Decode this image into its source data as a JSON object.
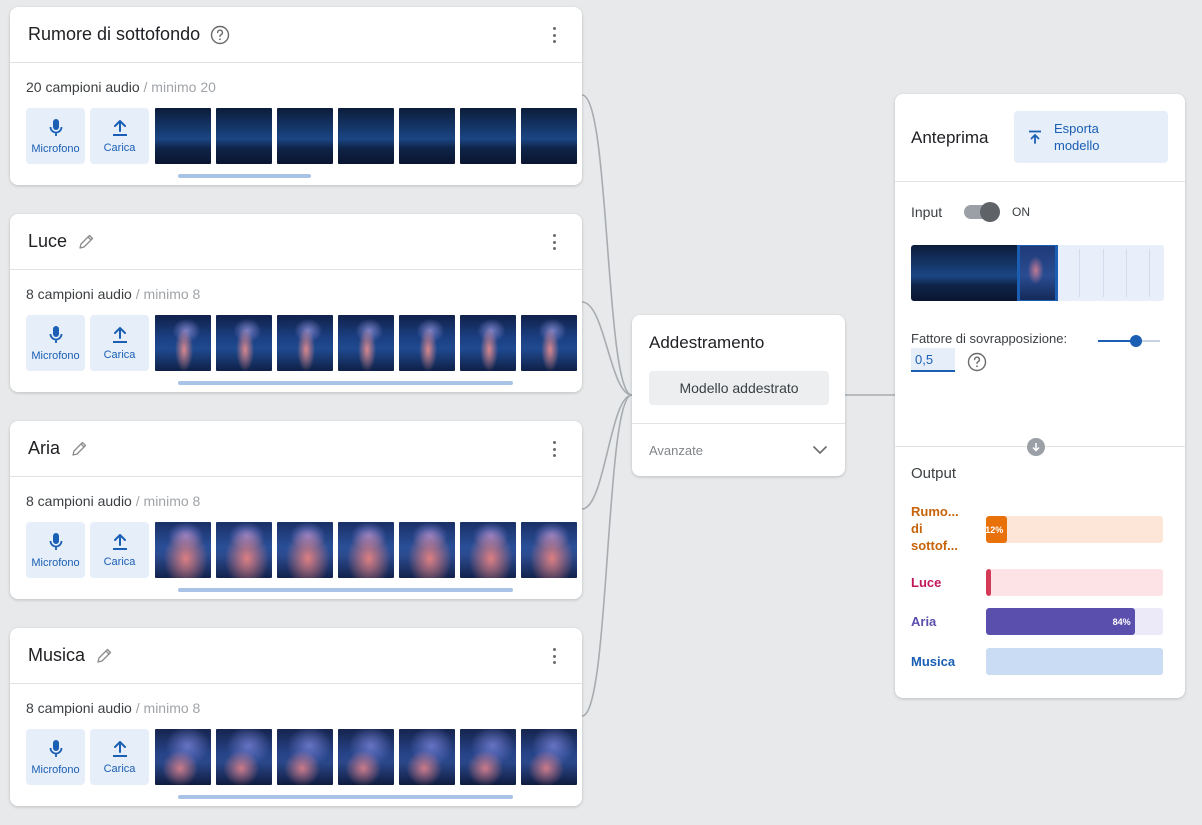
{
  "classes": [
    {
      "title": "Rumore di sottofondo",
      "count": "20 campioni audio",
      "minimum": "/ minimo 20",
      "microphone_label": "Microfono",
      "upload_label": "Carica",
      "head_icon": "help-circle-icon",
      "spectrogram_style": "background-noise"
    },
    {
      "title": "Luce",
      "count": "8 campioni audio",
      "minimum": "/ minimo 8",
      "microphone_label": "Microfono",
      "upload_label": "Carica",
      "head_icon": "pencil-icon",
      "spectrogram_style": "voice"
    },
    {
      "title": "Aria",
      "count": "8 campioni audio",
      "minimum": "/ minimo 8",
      "microphone_label": "Microfono",
      "upload_label": "Carica",
      "head_icon": "pencil-icon",
      "spectrogram_style": "air"
    },
    {
      "title": "Musica",
      "count": "8 campioni audio",
      "minimum": "/ minimo 8",
      "microphone_label": "Microfono",
      "upload_label": "Carica",
      "head_icon": "pencil-icon",
      "spectrogram_style": "music"
    }
  ],
  "training": {
    "title": "Addestramento",
    "button_label": "Modello addestrato",
    "advanced_label": "Avanzate"
  },
  "preview": {
    "title": "Anteprima",
    "export_label": "Esporta modello",
    "input_label": "Input",
    "toggle_state": "ON",
    "overlap_label": "Fattore di sovrapposizione:",
    "overlap_value": "0,5",
    "overlap_slider_fraction": 0.62,
    "output_label": "Output",
    "outputs": [
      {
        "label": "Rumo... di sottof...",
        "percent_label": "12%",
        "fraction": 0.12,
        "color": "#e8710a",
        "track": "#fde6d8",
        "text_color": "#c8640a"
      },
      {
        "label": "Luce",
        "percent_label": "",
        "fraction": 0.03,
        "color": "#d33a55",
        "track": "#fde2e6",
        "text_color": "#c2185b"
      },
      {
        "label": "Aria",
        "percent_label": "84%",
        "fraction": 0.84,
        "color": "#5b4fae",
        "track": "#ece9f8",
        "text_color": "#5b4fae"
      },
      {
        "label": "Musica",
        "percent_label": "",
        "fraction": 0.0,
        "color": "#1a73e8",
        "track": "#c9dcf4",
        "text_color": "#1a5fb4"
      }
    ]
  },
  "colors": {
    "accent": "#1a5fb4",
    "button_bg": "#e6eef9"
  }
}
